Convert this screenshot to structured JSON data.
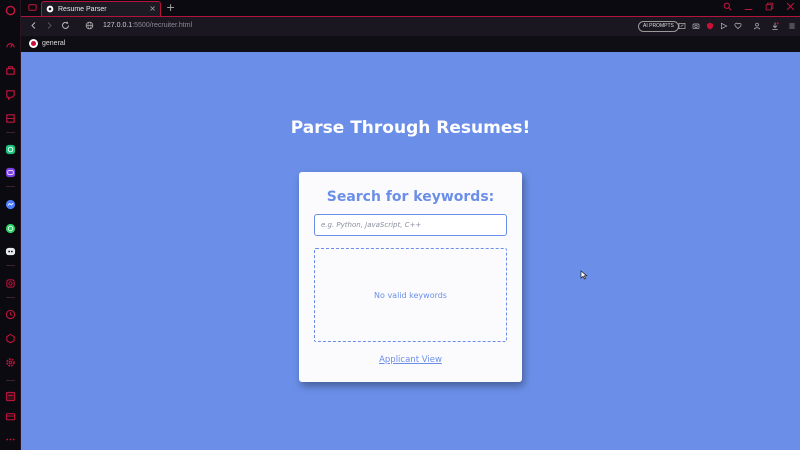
{
  "browser": {
    "tab_title": "Resume Parser",
    "tab_close": "×",
    "new_tab": "+",
    "url_host": "127.0.0.1",
    "url_rest": ":5500/recruiter.html",
    "ai_prompts_label": "AI PROMPTS",
    "bookmark_label": "general",
    "accent_color": "#b3133d"
  },
  "page": {
    "heading": "Parse Through Resumes!",
    "background_color": "#6b8fe8",
    "card": {
      "title": "Search for keywords:",
      "search_placeholder": "e.g. Python, JavaScript, C++",
      "search_value": "",
      "empty_message": "No valid keywords",
      "link_label": "Applicant View"
    }
  }
}
